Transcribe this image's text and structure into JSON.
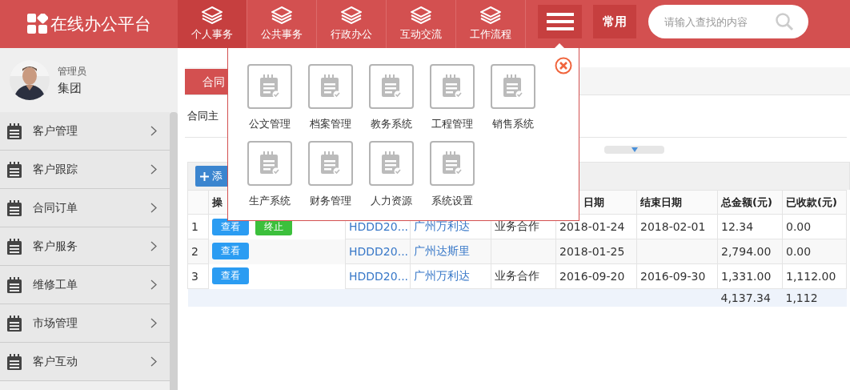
{
  "header": {
    "logo_text": "在线办公平台",
    "nav": [
      {
        "label": "个人事务",
        "selected": true
      },
      {
        "label": "公共事务",
        "selected": false
      },
      {
        "label": "行政办公",
        "selected": false
      },
      {
        "label": "互动交流",
        "selected": false
      },
      {
        "label": "工作流程",
        "selected": false
      }
    ],
    "common_button": "常用",
    "search": {
      "placeholder": "请输入查找的内容"
    }
  },
  "user": {
    "role": "管理员",
    "name": "集团"
  },
  "sidebar": {
    "items": [
      {
        "label": "客户管理"
      },
      {
        "label": "客户跟踪"
      },
      {
        "label": "合同订单"
      },
      {
        "label": "客户服务"
      },
      {
        "label": "维修工单"
      },
      {
        "label": "市场管理"
      },
      {
        "label": "客户互动"
      }
    ]
  },
  "content": {
    "tab": "合同",
    "filter_label": "合同主",
    "add_button": "添"
  },
  "table": {
    "action_header": "操",
    "columns": [
      null,
      null,
      null,
      "日期",
      "结束日期",
      "总金额(元)",
      "已收款(元)"
    ],
    "rows": [
      {
        "index": "1",
        "actions": [
          {
            "label": "查看",
            "kind": "view"
          },
          {
            "label": "终止",
            "kind": "stop"
          }
        ],
        "cells": [
          "HDDD20...",
          "广州万利达",
          "业务合作",
          "2018-01-24",
          "2018-02-01",
          "12.34",
          "0.00"
        ]
      },
      {
        "index": "2",
        "actions": [
          {
            "label": "查看",
            "kind": "view"
          }
        ],
        "cells": [
          "HDDD20...",
          "广州达斯里",
          null,
          "2018-01-25",
          null,
          "2,794.00",
          "0.00"
        ]
      },
      {
        "index": "3",
        "actions": [
          {
            "label": "查看",
            "kind": "view"
          }
        ],
        "cells": [
          "HDDD20...",
          "广州万利达",
          "业务合作",
          "2016-09-20",
          "2016-09-30",
          "1,331.00",
          "1,112.00"
        ]
      }
    ],
    "totals": [
      "4,137.34",
      "1,112"
    ]
  },
  "popup": {
    "items": [
      {
        "label": "公文管理"
      },
      {
        "label": "档案管理"
      },
      {
        "label": "教务系统"
      },
      {
        "label": "工程管理"
      },
      {
        "label": "销售系统"
      },
      {
        "label": "生产系统"
      },
      {
        "label": "财务管理"
      },
      {
        "label": "人力资源"
      },
      {
        "label": "系统设置"
      }
    ]
  }
}
